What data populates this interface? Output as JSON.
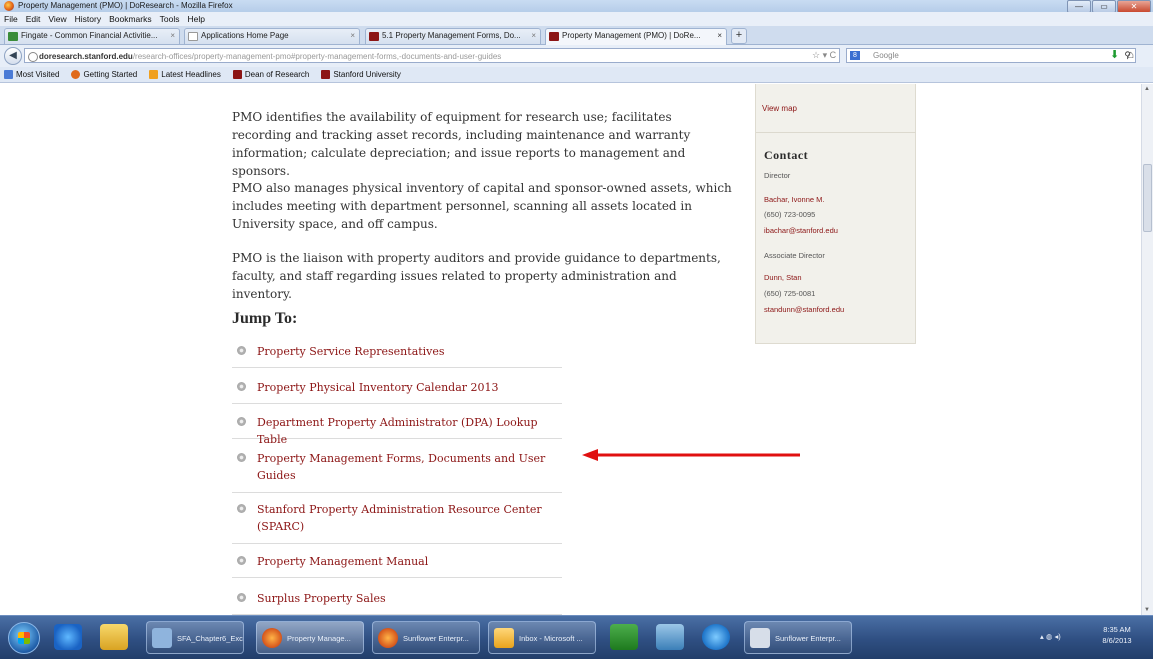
{
  "window": {
    "title": "Property Management (PMO) | DoResearch - Mozilla Firefox",
    "buttons": {
      "minimize": "—",
      "maximize": "▭",
      "close": "✕"
    }
  },
  "menu": [
    "File",
    "Edit",
    "View",
    "History",
    "Bookmarks",
    "Tools",
    "Help"
  ],
  "tabs": [
    {
      "label": "Fingate - Common Financial Activitie...",
      "close": "×",
      "icon_color": "#3a8c3a"
    },
    {
      "label": "Applications Home Page",
      "close": "×",
      "icon_color": "#ffffff"
    },
    {
      "label": "5.1 Property Management Forms, Do...",
      "close": "×",
      "icon_color": "#8c1515"
    },
    {
      "label": "Property Management (PMO) | DoRe...",
      "close": "×",
      "icon_color": "#8c1515"
    }
  ],
  "new_tab": "+",
  "nav": {
    "back": "◀",
    "url_host": "doresearch.stanford.edu",
    "url_path": "/research-offices/property-management-pmo#property-management-forms,-documents-and-user-guides",
    "url_controls": "☆ ▾ C",
    "search_engine": "Google",
    "search_icon": "⚲",
    "download": "⬇",
    "home": "⌂"
  },
  "bookmarks": [
    {
      "label": "Most Visited",
      "color": "#4b7bd6"
    },
    {
      "label": "Getting Started",
      "color": "#e06a1b"
    },
    {
      "label": "Latest Headlines",
      "color": "#f0a020"
    },
    {
      "label": "Dean of Research",
      "color": "#8c1515"
    },
    {
      "label": "Stanford University",
      "color": "#8c1515"
    }
  ],
  "content": {
    "paragraphs": [
      "PMO identifies the availability of equipment for research use; facilitates recording and tracking asset records, including maintenance and warranty information; calculate depreciation; and issue reports to management and sponsors.",
      "PMO also manages physical inventory of capital and sponsor-owned assets, which includes meeting with department personnel, scanning all assets located in University space, and off campus.",
      "PMO is the liaison with property auditors and provide guidance to departments, faculty, and staff regarding issues related to property administration and inventory."
    ],
    "jump_to_heading": "Jump To:",
    "jump_links": [
      "Property Service Representatives",
      "Property Physical Inventory Calendar 2013",
      "Department Property Administrator (DPA) Lookup Table",
      "Property Management Forms, Documents and User Guides",
      "Stanford Property Administration Resource Center (SPARC)",
      "Property Management Manual",
      "Surplus Property Sales"
    ]
  },
  "sidebar": {
    "view_map": "View map",
    "contact_heading": "Contact",
    "director_label": "Director",
    "director_name": "Bachar, Ivonne M.",
    "director_phone": "(650) 723-0095",
    "director_email": "ibachar@stanford.edu",
    "assoc_label": "Associate Director",
    "assoc_name": "Dunn, Stan",
    "assoc_phone": "(650) 725-0081",
    "assoc_email": "standunn@stanford.edu"
  },
  "annotation_arrow_color": "#e01010",
  "taskbar": {
    "buttons": [
      "SFA_Chapter6_Exc...",
      "Property Manage...",
      "Sunflower Enterpr...",
      "Inbox - Microsoft ...",
      "Sunflower Enterpr..."
    ],
    "tray": "▴ ◍ ◂)",
    "time": "8:35 AM",
    "date": "8/6/2013"
  }
}
